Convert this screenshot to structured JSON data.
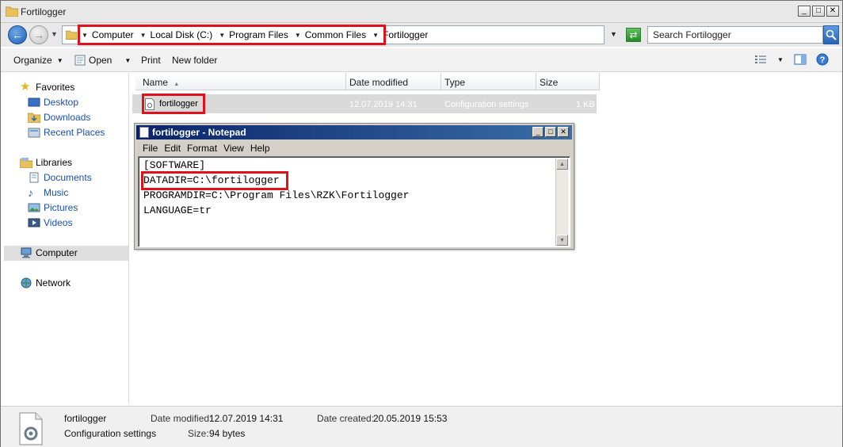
{
  "window": {
    "title": "Fortilogger"
  },
  "address": {
    "breadcrumb": [
      "Computer",
      "Local Disk (C:)",
      "Program Files",
      "Common Files",
      "Fortilogger"
    ],
    "search_placeholder": "Search Fortilogger"
  },
  "toolbar": {
    "organize": "Organize",
    "open": "Open",
    "print": "Print",
    "new_folder": "New folder"
  },
  "navpane": {
    "favorites": "Favorites",
    "desktop": "Desktop",
    "downloads": "Downloads",
    "recent_places": "Recent Places",
    "libraries": "Libraries",
    "documents": "Documents",
    "music": "Music",
    "pictures": "Pictures",
    "videos": "Videos",
    "computer": "Computer",
    "network": "Network"
  },
  "columns": {
    "name": "Name",
    "date_modified": "Date modified",
    "type": "Type",
    "size": "Size"
  },
  "file": {
    "name": "fortilogger",
    "date_modified": "12.07.2019 14:31",
    "type": "Configuration settings",
    "size": "1 KB"
  },
  "notepad": {
    "title": "fortilogger - Notepad",
    "menu": [
      "File",
      "Edit",
      "Format",
      "View",
      "Help"
    ],
    "lines": [
      "[SOFTWARE]",
      "DATADIR=C:\\fortilogger",
      "PROGRAMDIR=C:\\Program Files\\RZK\\Fortilogger",
      "LANGUAGE=tr"
    ]
  },
  "details": {
    "name": "fortilogger",
    "type": "Configuration settings",
    "date_modified_label": "Date modified:",
    "date_modified": "12.07.2019 14:31",
    "size_label": "Size:",
    "size": "94 bytes",
    "date_created_label": "Date created:",
    "date_created": "20.05.2019 15:53"
  },
  "colors": {
    "highlight_red": "#e0101c",
    "notepad_title": "#0a246a",
    "link_blue": "#1a4fb0"
  }
}
